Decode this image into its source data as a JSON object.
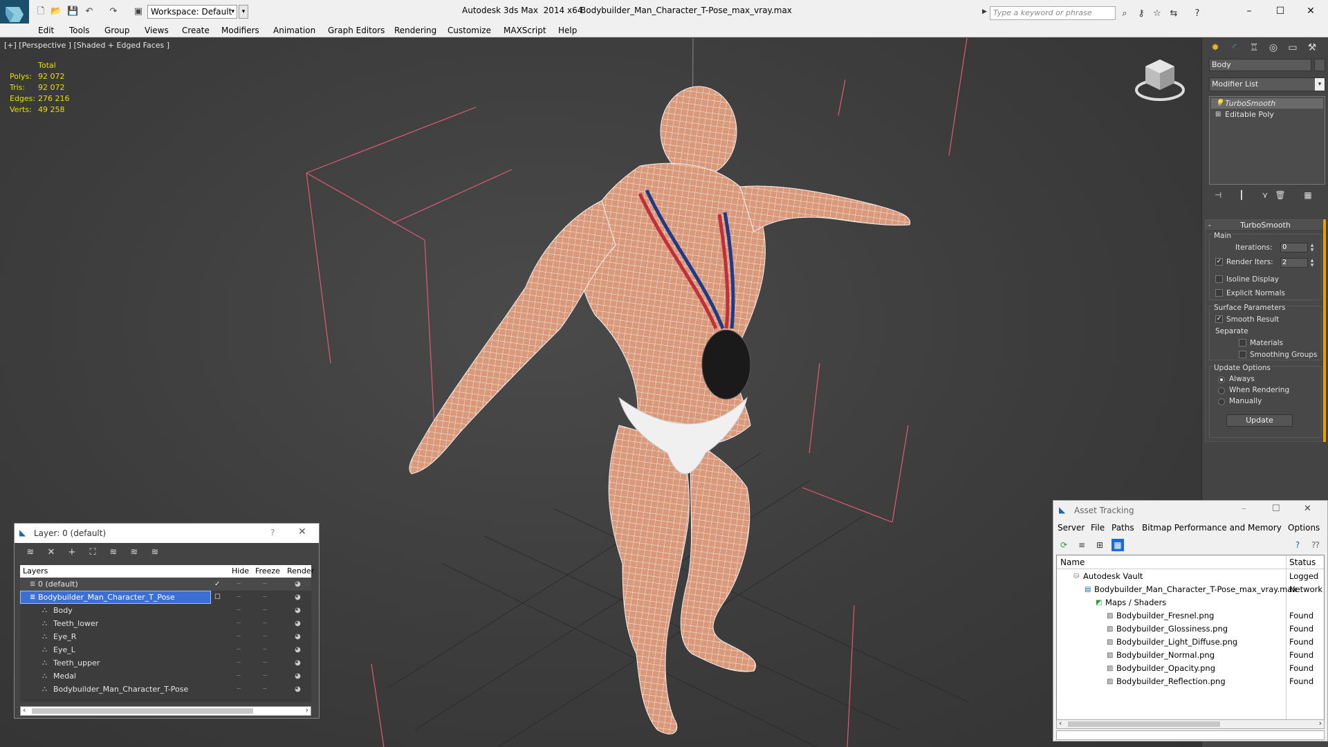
{
  "titlebar": {
    "app_title": "Autodesk 3ds Max  2014 x64",
    "file_name": "Bodybuilder_Man_Character_T-Pose_max_vray.max",
    "workspace": "Workspace: Default",
    "search_placeholder": "Type a keyword or phrase"
  },
  "menu": [
    "Edit",
    "Tools",
    "Group",
    "Views",
    "Create",
    "Modifiers",
    "Animation",
    "Graph Editors",
    "Rendering",
    "Customize",
    "MAXScript",
    "Help"
  ],
  "viewport": {
    "label": "[+] [Perspective ] [Shaded + Edged Faces ]",
    "stats_header": "Total",
    "stats": [
      {
        "key": "Polys:",
        "value": "92 072"
      },
      {
        "key": "Tris:",
        "value": "92 072"
      },
      {
        "key": "Edges:",
        "value": "276 216"
      },
      {
        "key": "Verts:",
        "value": "49 258"
      }
    ],
    "model_color": "#d9997a",
    "bbox_color": "#e05a78"
  },
  "command_panel": {
    "object_name": "Body",
    "modifier_list": "Modifier List",
    "stack": [
      "TurboSmooth",
      "Editable Poly"
    ],
    "rollout_title": "TurboSmooth",
    "main_label": "Main",
    "iterations_label": "Iterations:",
    "iterations_value": "0",
    "render_iters_label": "Render Iters:",
    "render_iters_value": "2",
    "isoline": "Isoline Display",
    "explicit_normals": "Explicit Normals",
    "surface_params": "Surface Parameters",
    "smooth_result": "Smooth Result",
    "separate": "Separate",
    "materials": "Materials",
    "smoothing_groups": "Smoothing Groups",
    "update_options": "Update Options",
    "always": "Always",
    "when_rendering": "When Rendering",
    "manually": "Manually",
    "update_button": "Update"
  },
  "layer_window": {
    "title": "Layer: 0 (default)",
    "help": "?",
    "columns": {
      "layers": "Layers",
      "hide": "Hide",
      "freeze": "Freeze",
      "render": "Render"
    },
    "rows": [
      {
        "name": "0 (default)",
        "level": 0
      },
      {
        "name": "Bodybuilder_Man_Character_T_Pose",
        "level": 0
      },
      {
        "name": "Body",
        "level": 1
      },
      {
        "name": "Teeth_lower",
        "level": 1
      },
      {
        "name": "Eye_R",
        "level": 1
      },
      {
        "name": "Eye_L",
        "level": 1
      },
      {
        "name": "Teeth_upper",
        "level": 1
      },
      {
        "name": "Medal",
        "level": 1
      },
      {
        "name": "Bodybuilder_Man_Character_T-Pose",
        "level": 1
      }
    ]
  },
  "asset_window": {
    "title": "Asset Tracking",
    "menu": [
      "Server",
      "File",
      "Paths",
      "Bitmap Performance and Memory",
      "Options"
    ],
    "columns": {
      "name": "Name",
      "status": "Status"
    },
    "rows": [
      {
        "name": "Autodesk Vault",
        "status": "Logged",
        "level": 0
      },
      {
        "name": "Bodybuilder_Man_Character_T-Pose_max_vray.max",
        "status": "Network",
        "level": 1
      },
      {
        "name": "Maps / Shaders",
        "status": "",
        "level": 2
      },
      {
        "name": "Bodybuilder_Fresnel.png",
        "status": "Found",
        "level": 3
      },
      {
        "name": "Bodybuilder_Glossiness.png",
        "status": "Found",
        "level": 3
      },
      {
        "name": "Bodybuilder_Light_Diffuse.png",
        "status": "Found",
        "level": 3
      },
      {
        "name": "Bodybuilder_Normal.png",
        "status": "Found",
        "level": 3
      },
      {
        "name": "Bodybuilder_Opacity.png",
        "status": "Found",
        "level": 3
      },
      {
        "name": "Bodybuilder_Reflection.png",
        "status": "Found",
        "level": 3
      }
    ]
  }
}
